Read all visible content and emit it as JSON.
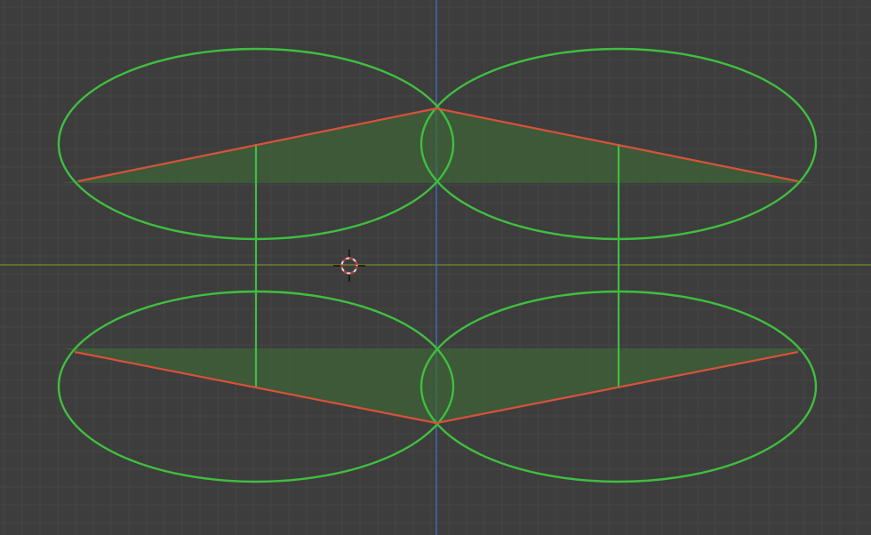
{
  "viewport": {
    "name": "3D Viewport",
    "colors": {
      "background": "#3d3d3d",
      "grid_minor": "#454545",
      "grid_major": "#4a4a4a",
      "axis_x": "#6f8a2e",
      "axis_y": "#3f78c4",
      "wire_green": "#3fbf3f",
      "edge_red": "#d9513a",
      "face_fill": "#3d6a35",
      "cursor_ring": "#d9d9d9",
      "cursor_dash": "#cc2a2a"
    }
  },
  "objects": [
    {
      "name": "ellipse-top-left",
      "type": "ellipse"
    },
    {
      "name": "ellipse-top-right",
      "type": "ellipse"
    },
    {
      "name": "ellipse-bottom-left",
      "type": "ellipse"
    },
    {
      "name": "ellipse-bottom-right",
      "type": "ellipse"
    },
    {
      "name": "triangle-top-left",
      "type": "face"
    },
    {
      "name": "triangle-top-right",
      "type": "face"
    },
    {
      "name": "triangle-bottom-left",
      "type": "face"
    },
    {
      "name": "triangle-bottom-right",
      "type": "face"
    }
  ],
  "cursor": {
    "icon": "3d-cursor-icon"
  }
}
